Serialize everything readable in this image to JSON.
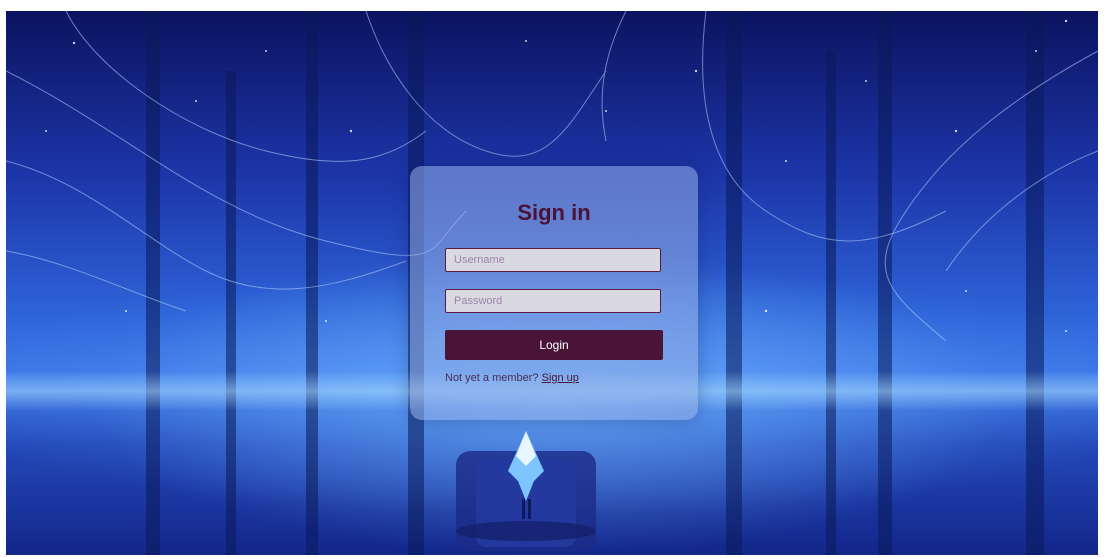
{
  "signin": {
    "title": "Sign in",
    "username_placeholder": "Username",
    "password_placeholder": "Password",
    "login_label": "Login",
    "prompt_text": "Not yet a member?",
    "signup_label": "Sign up"
  },
  "colors": {
    "title": "#4a1237",
    "button": "#4a1438",
    "card": "rgba(150,175,230,0.55)",
    "background_top": "#0c1460",
    "background_mid": "#3f7ae8"
  }
}
